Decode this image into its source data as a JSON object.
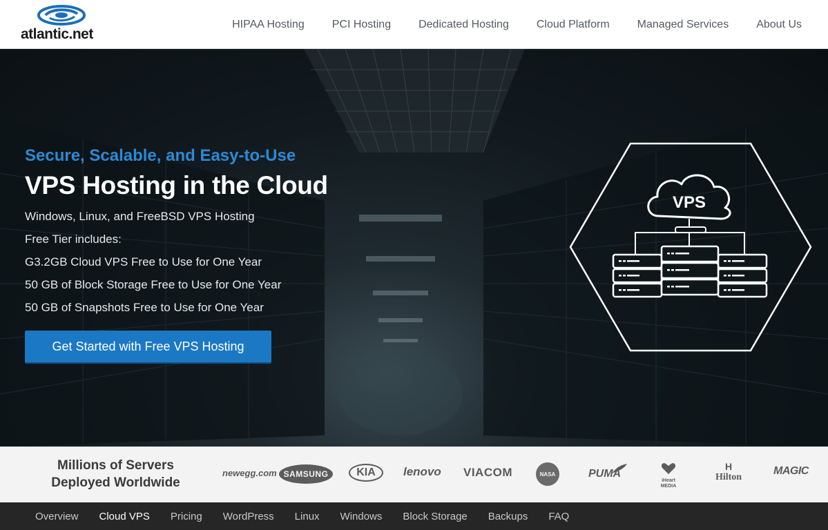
{
  "header": {
    "logo_text": "atlantic.net",
    "nav": [
      "HIPAA Hosting",
      "PCI Hosting",
      "Dedicated Hosting",
      "Cloud Platform",
      "Managed Services",
      "About Us"
    ]
  },
  "hero": {
    "subtitle": "Secure, Scalable, and Easy-to-Use",
    "title": "VPS Hosting in the Cloud",
    "lines": [
      "Windows, Linux, and FreeBSD VPS Hosting",
      "Free Tier includes:",
      "G3.2GB Cloud VPS Free to Use for One Year",
      "50 GB of Block Storage Free to Use for One Year",
      "50 GB of Snapshots Free to Use for One Year"
    ],
    "cta_label": "Get Started with Free VPS Hosting",
    "graphic_label": "VPS"
  },
  "clients": {
    "title": "Millions of Servers Deployed Worldwide",
    "brands": [
      "newegg.com",
      "SAMSUNG",
      "KIA",
      "lenovo",
      "VIACOM",
      "NASA",
      "PUMA",
      "iHeart MEDIA",
      "Hilton",
      "MAGIC"
    ]
  },
  "subnav": {
    "items": [
      "Overview",
      "Cloud VPS",
      "Pricing",
      "WordPress",
      "Linux",
      "Windows",
      "Block Storage",
      "Backups",
      "FAQ"
    ],
    "active": "Cloud VPS"
  },
  "colors": {
    "accent_blue": "#2b8ad6",
    "cta_blue": "#1b78c4",
    "subnav_bg": "#262626"
  }
}
